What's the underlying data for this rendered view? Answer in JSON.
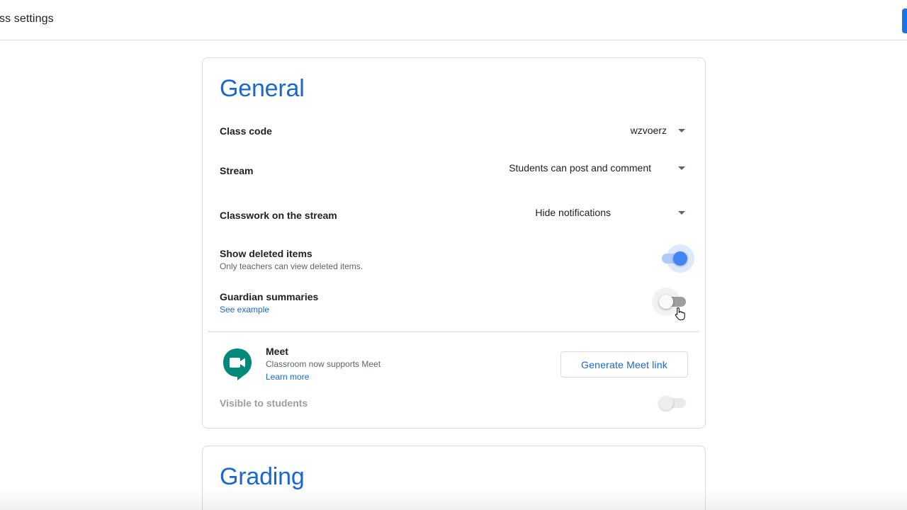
{
  "topbar": {
    "title": "ass settings",
    "accent_color": "#1a73e8"
  },
  "general": {
    "heading": "General",
    "class_code": {
      "label": "Class code",
      "value": "wzvoerz"
    },
    "stream": {
      "label": "Stream",
      "value": "Students can post and comment"
    },
    "classwork": {
      "label": "Classwork on the stream",
      "value": "Hide notifications"
    },
    "show_deleted": {
      "label": "Show deleted items",
      "sub": "Only teachers can view deleted items.",
      "checked": true
    },
    "guardian": {
      "label": "Guardian summaries",
      "link": "See example",
      "checked": false
    },
    "meet": {
      "title": "Meet",
      "sub": "Classroom now supports Meet",
      "link": "Learn more",
      "button": "Generate Meet link",
      "icon": "google-meet-icon"
    },
    "visible": {
      "label": "Visible to students",
      "checked": false,
      "disabled": true
    }
  },
  "grading": {
    "heading": "Grading"
  },
  "colors": {
    "heading": "#1967d2",
    "toggle_on": "#4285f4",
    "meet_green": "#00897b"
  }
}
